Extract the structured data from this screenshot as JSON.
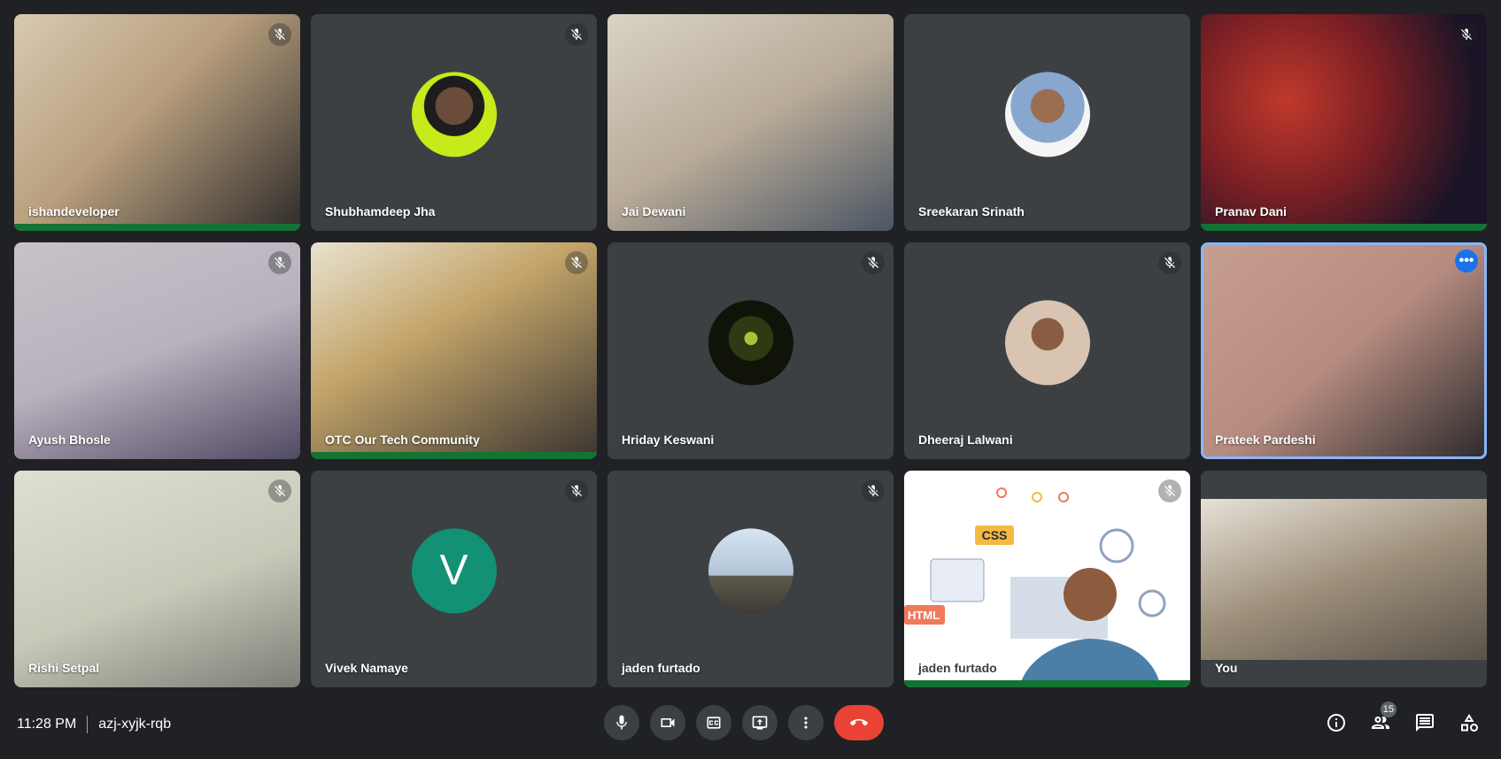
{
  "participants": [
    {
      "name": "ishandeveloper"
    },
    {
      "name": "Shubhamdeep Jha"
    },
    {
      "name": "Jai Dewani"
    },
    {
      "name": "Sreekaran Srinath"
    },
    {
      "name": "Pranav Dani"
    },
    {
      "name": "Ayush Bhosle"
    },
    {
      "name": "OTC Our Tech Community"
    },
    {
      "name": "Hriday Keswani"
    },
    {
      "name": "Dheeraj Lalwani"
    },
    {
      "name": "Prateek Pardeshi"
    },
    {
      "name": "Rishi Setpal"
    },
    {
      "name": "Vivek Namaye",
      "avatar_letter": "V"
    },
    {
      "name": "jaden furtado"
    },
    {
      "name": "jaden furtado"
    },
    {
      "name": "You"
    }
  ],
  "presentation_text": {
    "css": "CSS",
    "html": "HTML"
  },
  "meeting": {
    "time": "11:28 PM",
    "code": "azj-xyjk-rqb"
  },
  "people_count": "15",
  "colors": {
    "background": "#202124",
    "tile": "#3c4043",
    "end_call": "#ea4335",
    "speaking": "#137333",
    "pinned_outline": "#8ab4f8"
  },
  "icons": {
    "mic": "mic-icon",
    "camera": "camera-icon",
    "captions": "captions-icon",
    "present": "present-icon",
    "more": "more-vert-icon",
    "end": "end-call-icon",
    "info": "info-icon",
    "people": "people-icon",
    "chat": "chat-icon",
    "activities": "activities-icon"
  }
}
